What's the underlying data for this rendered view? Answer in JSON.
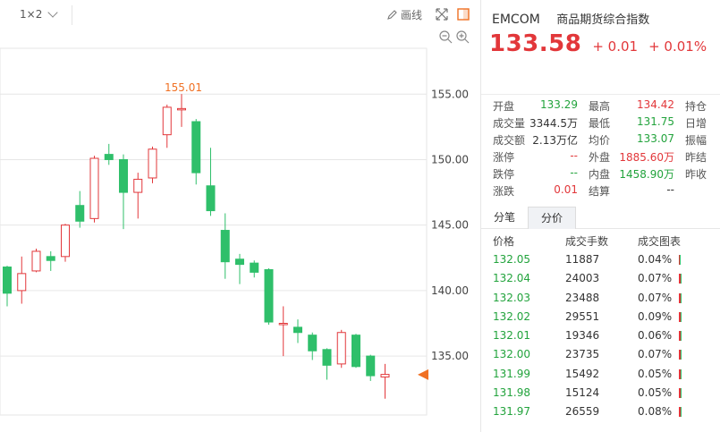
{
  "toolbar": {
    "layout_label": "1×2",
    "draw_label": "画线"
  },
  "axis": {
    "y_ticks": [
      "155.00",
      "150.00",
      "145.00",
      "140.00",
      "135.00"
    ]
  },
  "chart_data": {
    "type": "candlestick",
    "ylim": [
      130.5,
      158.5
    ],
    "y_ticks": [
      155,
      150,
      145,
      140,
      135
    ],
    "high_label": "155.01",
    "current_price": 133.58,
    "candles": [
      {
        "o": 141.8,
        "c": 139.8,
        "h": 141.9,
        "l": 138.8
      },
      {
        "o": 140.0,
        "c": 141.3,
        "h": 142.6,
        "l": 139.0
      },
      {
        "o": 141.5,
        "c": 143.0,
        "h": 143.2,
        "l": 141.4
      },
      {
        "o": 142.6,
        "c": 142.3,
        "h": 143.0,
        "l": 141.5
      },
      {
        "o": 142.6,
        "c": 145.0,
        "h": 145.1,
        "l": 142.2
      },
      {
        "o": 146.5,
        "c": 145.3,
        "h": 147.6,
        "l": 144.8
      },
      {
        "o": 145.5,
        "c": 150.1,
        "h": 150.3,
        "l": 145.2
      },
      {
        "o": 150.4,
        "c": 150.0,
        "h": 151.2,
        "l": 149.6
      },
      {
        "o": 150.0,
        "c": 147.5,
        "h": 150.4,
        "l": 144.7
      },
      {
        "o": 147.5,
        "c": 148.5,
        "h": 149.0,
        "l": 145.5
      },
      {
        "o": 148.6,
        "c": 150.8,
        "h": 151.0,
        "l": 148.2
      },
      {
        "o": 151.9,
        "c": 154.0,
        "h": 154.2,
        "l": 150.9
      },
      {
        "o": 153.9,
        "c": 153.9,
        "h": 155.01,
        "l": 152.5
      },
      {
        "o": 152.9,
        "c": 149.0,
        "h": 153.1,
        "l": 148.1
      },
      {
        "o": 148.0,
        "c": 146.1,
        "h": 150.9,
        "l": 145.7
      },
      {
        "o": 144.6,
        "c": 142.2,
        "h": 145.9,
        "l": 140.9
      },
      {
        "o": 142.4,
        "c": 142.0,
        "h": 142.8,
        "l": 140.5
      },
      {
        "o": 142.1,
        "c": 141.4,
        "h": 142.3,
        "l": 141.0
      },
      {
        "o": 141.6,
        "c": 137.6,
        "h": 141.7,
        "l": 137.4
      },
      {
        "o": 137.5,
        "c": 137.5,
        "h": 138.8,
        "l": 135.0
      },
      {
        "o": 137.2,
        "c": 136.8,
        "h": 137.8,
        "l": 136.0
      },
      {
        "o": 136.6,
        "c": 135.4,
        "h": 136.8,
        "l": 134.7
      },
      {
        "o": 135.5,
        "c": 134.3,
        "h": 135.6,
        "l": 133.2
      },
      {
        "o": 134.4,
        "c": 136.8,
        "h": 137.0,
        "l": 134.1
      },
      {
        "o": 136.6,
        "c": 134.2,
        "h": 136.7,
        "l": 134.1
      },
      {
        "o": 135.0,
        "c": 133.5,
        "h": 135.1,
        "l": 133.1
      },
      {
        "o": 133.4,
        "c": 133.6,
        "h": 134.4,
        "l": 131.75
      }
    ]
  },
  "quote": {
    "code": "EMCOM",
    "name": "商品期货综合指数",
    "price": "133.58",
    "change": "+ 0.01",
    "change_pct": "+ 0.01%",
    "stats": [
      [
        "开盘",
        "133.29",
        "最高",
        "134.42",
        "持仓"
      ],
      [
        "成交量",
        "3344.5万",
        "最低",
        "131.75",
        "日增"
      ],
      [
        "成交额",
        "2.13万亿",
        "均价",
        "133.07",
        "振幅"
      ],
      [
        "涨停",
        "--",
        "外盘",
        "1885.60万",
        "昨结"
      ],
      [
        "跌停",
        "--",
        "内盘",
        "1458.90万",
        "昨收"
      ],
      [
        "涨跌",
        "0.01",
        "结算",
        "--",
        ""
      ]
    ]
  },
  "tabs": [
    "分笔",
    "分价"
  ],
  "table": {
    "headers": [
      "价格",
      "成交手数",
      "成交图表"
    ],
    "rows": [
      {
        "price": "132.05",
        "volume": "11887",
        "pct": "0.04%",
        "share": 0.04
      },
      {
        "price": "132.04",
        "volume": "24003",
        "pct": "0.07%",
        "share": 0.07
      },
      {
        "price": "132.03",
        "volume": "23488",
        "pct": "0.07%",
        "share": 0.07
      },
      {
        "price": "132.02",
        "volume": "29551",
        "pct": "0.09%",
        "share": 0.09
      },
      {
        "price": "132.01",
        "volume": "19346",
        "pct": "0.06%",
        "share": 0.06
      },
      {
        "price": "132.00",
        "volume": "23735",
        "pct": "0.07%",
        "share": 0.07
      },
      {
        "price": "131.99",
        "volume": "15492",
        "pct": "0.05%",
        "share": 0.05
      },
      {
        "price": "131.98",
        "volume": "15124",
        "pct": "0.05%",
        "share": 0.05
      },
      {
        "price": "131.97",
        "volume": "26559",
        "pct": "0.08%",
        "share": 0.08
      }
    ]
  },
  "colors": {
    "up": "#e2373a",
    "down": "#2fbf6a",
    "grid": "#e6e6e6",
    "accent": "#f07023"
  }
}
